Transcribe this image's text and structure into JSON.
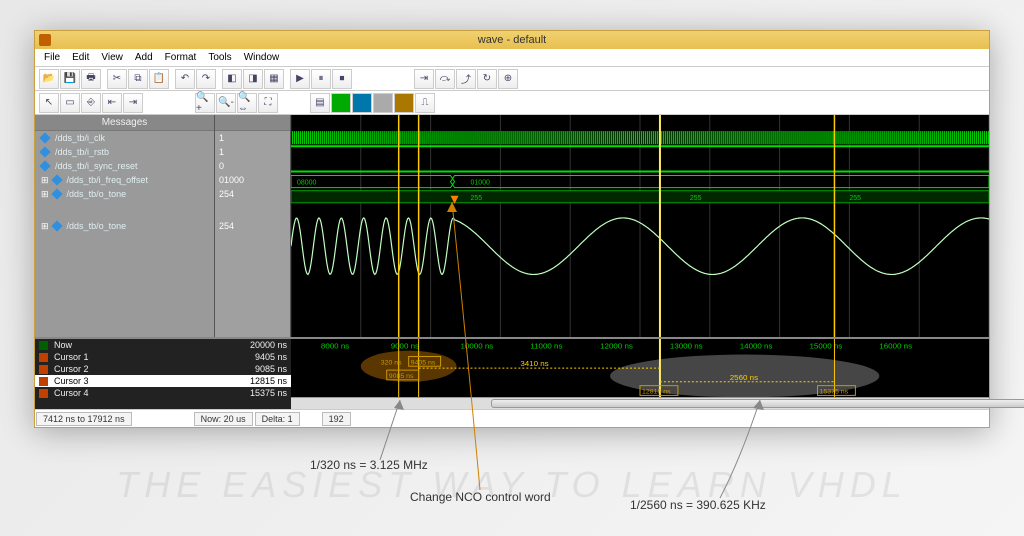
{
  "window": {
    "title": "wave - default"
  },
  "menus": [
    "File",
    "Edit",
    "View",
    "Add",
    "Format",
    "Tools",
    "Window"
  ],
  "panels": {
    "messages_header": "Messages"
  },
  "signals": [
    {
      "name": "/dds_tb/i_clk",
      "value": "1"
    },
    {
      "name": "/dds_tb/i_rstb",
      "value": "1"
    },
    {
      "name": "/dds_tb/i_sync_reset",
      "value": "0"
    },
    {
      "name": "/dds_tb/i_freq_offset",
      "value": "01000"
    },
    {
      "name": "/dds_tb/o_tone",
      "value": "254"
    },
    {
      "name": "/dds_tb/o_tone",
      "value": "254"
    }
  ],
  "bus_values": {
    "left": "08000",
    "center": "01000"
  },
  "tone_values": [
    "255",
    "255",
    "255"
  ],
  "cursors": {
    "now_label": "Now",
    "now_value": "20000 ns",
    "rows": [
      {
        "label": "Cursor 1",
        "value": "9405 ns"
      },
      {
        "label": "Cursor 2",
        "value": "9085 ns"
      },
      {
        "label": "Cursor 3",
        "value": "12815 ns"
      },
      {
        "label": "Cursor 4",
        "value": "15375 ns"
      }
    ],
    "selected_index": 2
  },
  "ruler_ticks": [
    "8000 ns",
    "9000 ns",
    "10000 ns",
    "11000 ns",
    "12000 ns",
    "13000 ns",
    "14000 ns",
    "15000 ns",
    "16000 ns"
  ],
  "measurements": {
    "delta_small": "320 ns",
    "delta_small_top": "9405 ns",
    "delta_small_bot": "9085 ns",
    "delta_mid": "3410 ns",
    "delta_big": "2560 ns",
    "big_left": "12815 ns",
    "big_right": "15375 ns"
  },
  "status": {
    "range": "7412 ns to 17912 ns",
    "now": "Now: 20 us",
    "delta": "Delta: 1",
    "extra": "192"
  },
  "annotations": {
    "a1": "1/320 ns = 3.125 MHz",
    "a2": "Change NCO control word",
    "a3": "1/2560 ns = 390.625 KHz"
  }
}
